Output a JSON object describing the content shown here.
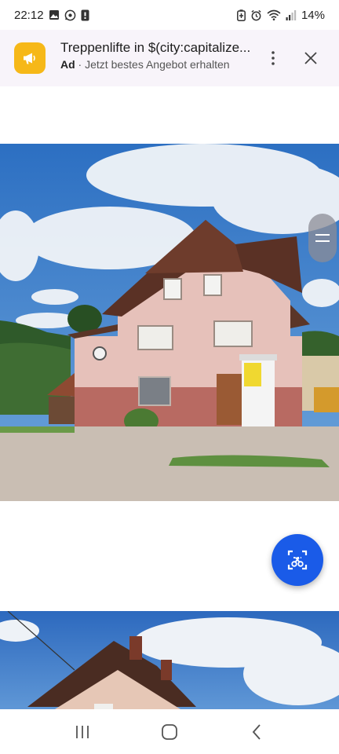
{
  "status_bar": {
    "time": "22:12",
    "battery": "14%",
    "icons_left": [
      "gallery-icon",
      "whatsapp-icon",
      "notification-icon"
    ],
    "icons_right": [
      "battery-saver-icon",
      "alarm-icon",
      "wifi-icon",
      "signal-icon"
    ]
  },
  "ad": {
    "title": "Treppenlifte in $(city:capitalize...",
    "badge": "Ad",
    "separator": " · ",
    "subtitle": "Jetzt bestes Angebot erhalten",
    "logo_color": "#f6b818"
  },
  "photos": [
    {
      "subject": "building-photo",
      "index": 1
    },
    {
      "subject": "building-photo",
      "index": 2
    }
  ],
  "fab": {
    "icon": "screenshot-crop-icon",
    "color": "#1a5be8"
  },
  "nav": {
    "items": [
      "recent-apps",
      "home",
      "back"
    ]
  }
}
